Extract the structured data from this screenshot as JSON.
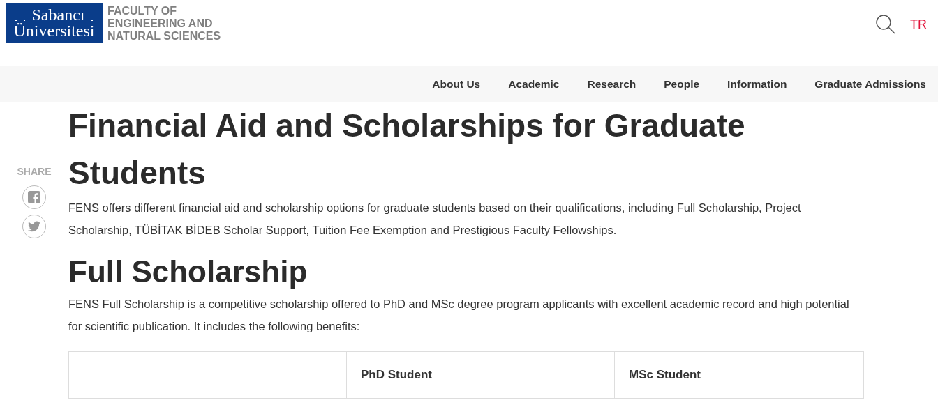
{
  "logo": {
    "line_1": "Sabancı",
    "line_2": "Üniversitesi"
  },
  "faculty": [
    "FACULTY OF",
    "ENGINEERING AND",
    "NATURAL SCIENCES"
  ],
  "language": "TR",
  "nav": [
    "About Us",
    "Academic",
    "Research",
    "People",
    "Information",
    "Graduate Admissions"
  ],
  "share": {
    "label": "SHARE"
  },
  "title": "Financial Aid and Scholarships for Graduate Students",
  "intro": "FENS offers different financial aid and scholarship options for graduate students based on their qualifications, including Full Scholarship, Project Scholarship, TÜBİTAK BİDEB Scholar Support, Tuition Fee Exemption and Prestigious Faculty Fellowships.",
  "section": {
    "heading": "Full Scholarship",
    "text": "FENS Full Scholarship is a competitive scholarship offered to PhD and MSc degree program applicants with excellent academic record and high potential for scientific publication. It includes the following benefits:"
  },
  "table": {
    "columns": [
      "PhD Student",
      "MSc Student"
    ]
  }
}
